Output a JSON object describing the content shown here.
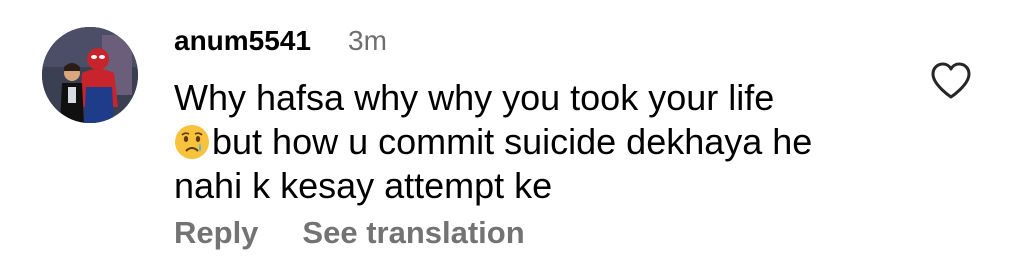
{
  "comment": {
    "username": "anum5541",
    "timestamp": "3m",
    "text_line1": "Why hafsa why why you took your life",
    "text_line2": "but how u commit suicide dekhaya he",
    "text_line3": "nahi k kesay attempt ke",
    "emoji_icon": "crying-face-icon",
    "reply_label": "Reply",
    "translation_label": "See translation"
  },
  "colors": {
    "username": "#000000",
    "timestamp": "#6e6e6e",
    "action_text": "#737373",
    "heart_stroke": "#262626"
  }
}
